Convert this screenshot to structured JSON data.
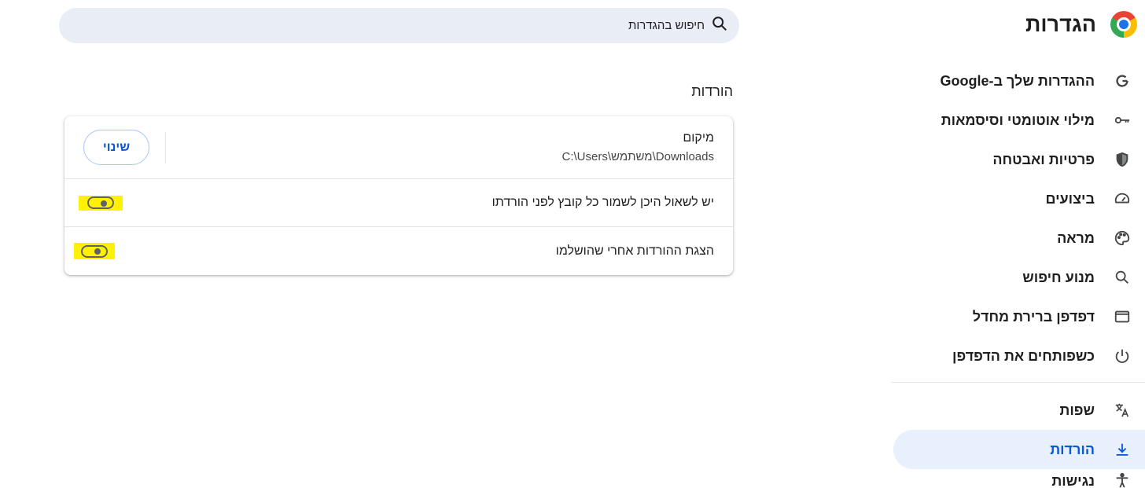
{
  "header": {
    "title": "הגדרות",
    "logo_icon": "chrome-logo-icon"
  },
  "search": {
    "placeholder": "חיפוש בהגדרות",
    "icon": "search-icon"
  },
  "sidebar": {
    "items": [
      {
        "label": "ההגדרות שלך ב-Google",
        "icon": "google-g-icon"
      },
      {
        "label": "מילוי אוטומטי וסיסמאות",
        "icon": "key-icon"
      },
      {
        "label": "פרטיות ואבטחה",
        "icon": "shield-icon"
      },
      {
        "label": "ביצועים",
        "icon": "speedometer-icon"
      },
      {
        "label": "מראה",
        "icon": "palette-icon"
      },
      {
        "label": "מנוע חיפוש",
        "icon": "search-icon"
      },
      {
        "label": "דפדפן ברירת מחדל",
        "icon": "browser-window-icon"
      },
      {
        "label": "כשפותחים את הדפדפן",
        "icon": "power-icon"
      }
    ],
    "items_after_divider": [
      {
        "label": "שפות",
        "icon": "translate-icon"
      },
      {
        "label": "הורדות",
        "icon": "download-icon",
        "active": true
      },
      {
        "label": "נגישות",
        "icon": "accessibility-icon"
      }
    ]
  },
  "downloads": {
    "section_title": "הורדות",
    "location": {
      "label": "מיקום",
      "path": "C:\\Users\\משתמש\\Downloads",
      "change_button": "שינוי"
    },
    "ask_where_to_save": {
      "label": "יש לשאול היכן לשמור כל קובץ לפני הורדתו",
      "enabled": false
    },
    "show_downloads_when_done": {
      "label": "הצגת ההורדות אחרי שהושלמו",
      "enabled": false
    }
  },
  "colors": {
    "accent": "#0b57d0",
    "active_bg": "#e8f0fe",
    "search_bg": "#e9eef6",
    "highlight": "#fff200"
  }
}
